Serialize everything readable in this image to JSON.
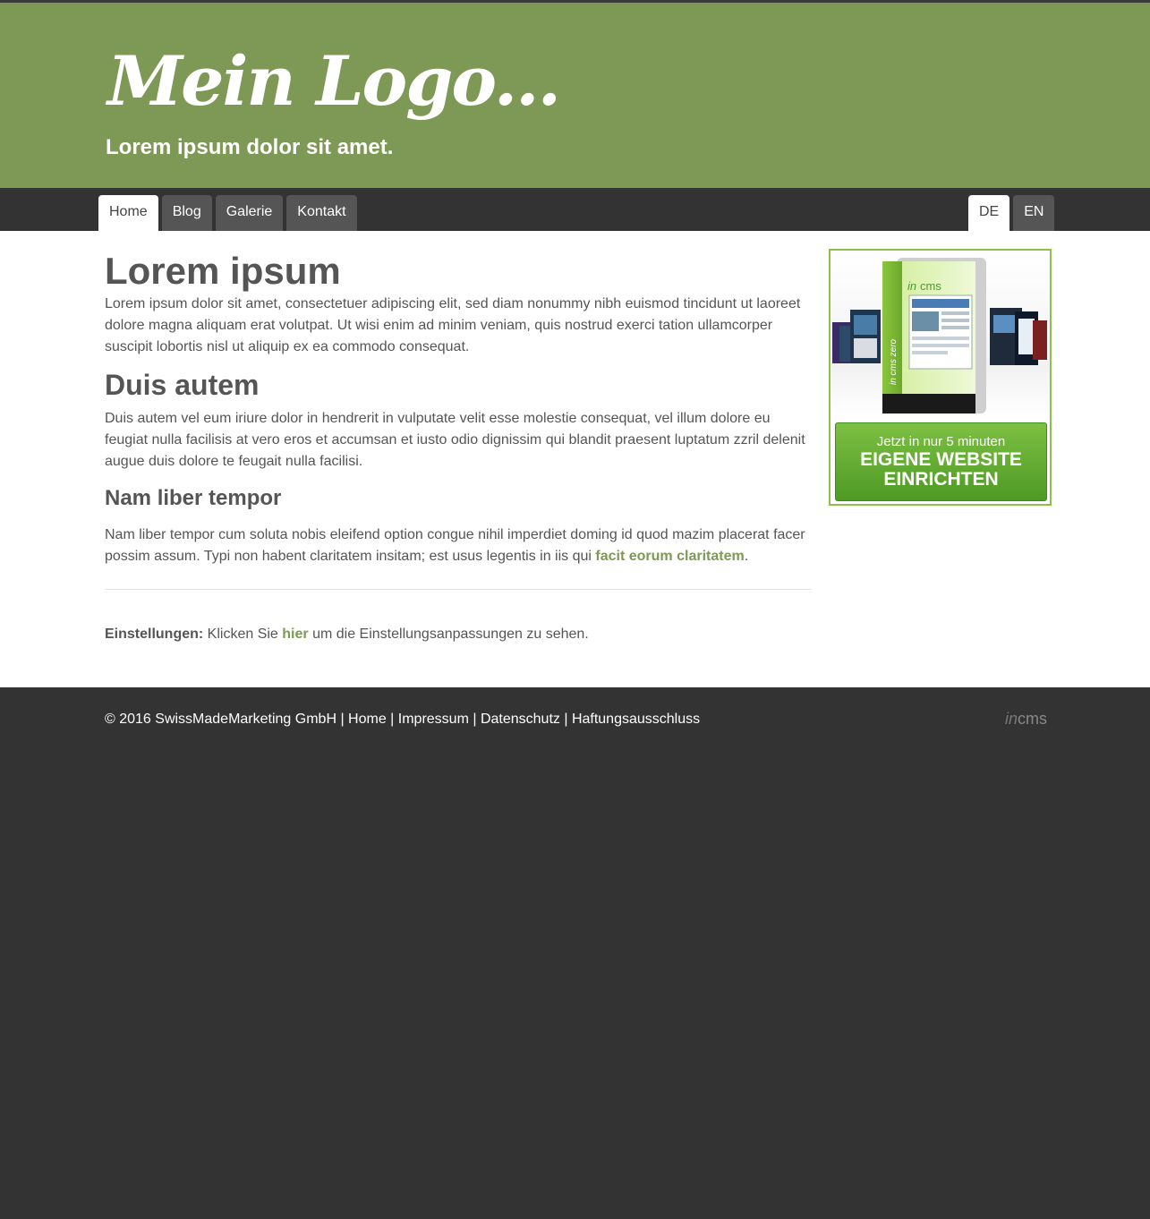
{
  "header": {
    "logo": "Mein Logo...",
    "tagline": "Lorem ipsum dolor sit amet."
  },
  "nav": {
    "items": [
      {
        "label": "Home",
        "active": true
      },
      {
        "label": "Blog",
        "active": false
      },
      {
        "label": "Galerie",
        "active": false
      },
      {
        "label": "Kontakt",
        "active": false
      }
    ],
    "languages": [
      {
        "label": "DE",
        "active": true
      },
      {
        "label": "EN",
        "active": false
      }
    ]
  },
  "main": {
    "h1": "Lorem ipsum",
    "p1": "Lorem ipsum dolor sit amet, consectetuer adipiscing elit, sed diam nonummy nibh euismod tincidunt ut laoreet dolore magna aliquam erat volutpat. Ut wisi enim ad minim veniam, quis nostrud exerci tation ullamcorper suscipit lobortis nisl ut aliquip ex ea commodo consequat.",
    "h2": "Duis autem",
    "p2": "Duis autem vel eum iriure dolor in hendrerit in vulputate velit esse molestie consequat, vel illum dolore eu feugiat nulla facilisis at vero eros et accumsan et iusto odio dignissim qui blandit praesent luptatum zzril delenit augue duis dolore te feugait nulla facilisi.",
    "h3": "Nam liber tempor",
    "p3_text": "Nam liber tempor cum soluta nobis eleifend option congue nihil imperdiet doming id quod mazim placerat facer possim assum. Typi non habent claritatem insitam; est usus legentis in iis qui ",
    "p3_link": "facit eorum claritatem",
    "p3_end": ".",
    "settings_label": "Einstellungen:",
    "settings_text": " Klicken Sie ",
    "settings_link": "hier",
    "settings_end": " um die Einstellungsanpassungen zu sehen."
  },
  "ad": {
    "box_brand_in": "in",
    "box_brand_cms": "cms",
    "box_side_text": "in cms zero",
    "line1": "Jetzt in nur 5 minuten",
    "line2": "EIGENE WEBSITE",
    "line3": "EINRICHTEN"
  },
  "footer": {
    "copyright": "© 2016 SwissMadeMarketing GmbH",
    "links": [
      "Home",
      "Impressum",
      "Datenschutz",
      "Haftungsausschluss"
    ],
    "separator": " | ",
    "brand_in": "in",
    "brand_cms": "cms"
  },
  "colors": {
    "header_green": "#7e9955",
    "dark": "#333333",
    "tab_inactive": "#555555",
    "link_green": "#7e9955",
    "ad_border": "#8dc04a",
    "ad_button": "#5fae2f"
  }
}
